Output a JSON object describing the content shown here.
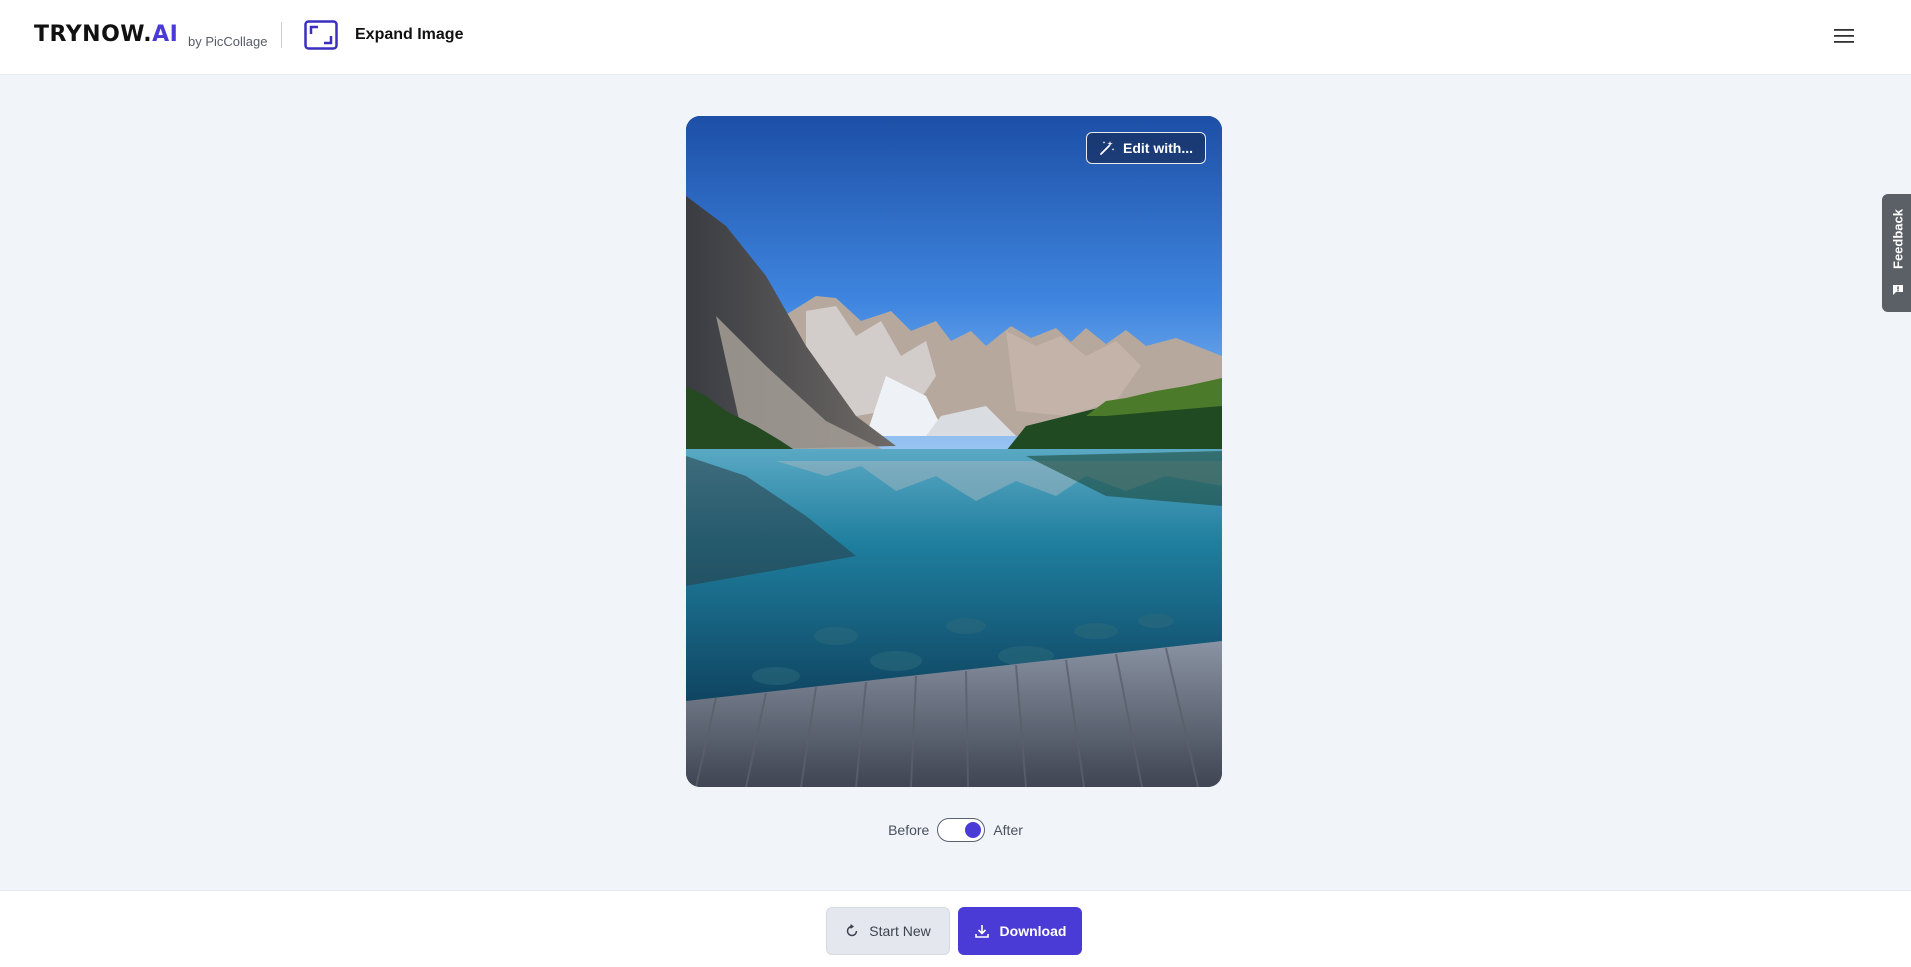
{
  "header": {
    "brand_main": "TRYNOW.",
    "brand_accent": "AI",
    "by_line": "by PicCollage",
    "tool_icon": "expand-frame-icon",
    "tool_title": "Expand Image",
    "menu_icon": "hamburger-menu-icon"
  },
  "image_card": {
    "edit_label": "Edit with...",
    "edit_icon": "magic-wand-icon",
    "image_description_icon": "landscape-photo"
  },
  "compare": {
    "before_label": "Before",
    "after_label": "After",
    "toggle_state": "after"
  },
  "footer": {
    "start_new_label": "Start New",
    "start_new_icon": "refresh-icon",
    "download_label": "Download",
    "download_icon": "download-icon"
  },
  "feedback": {
    "label": "Feedback",
    "icon": "chat-bubble-icon"
  },
  "colors": {
    "accent": "#4b3bd6",
    "page_background": "#f1f4f8",
    "secondary_button": "#e4e8ee",
    "feedback_tab": "#5b5f66"
  }
}
